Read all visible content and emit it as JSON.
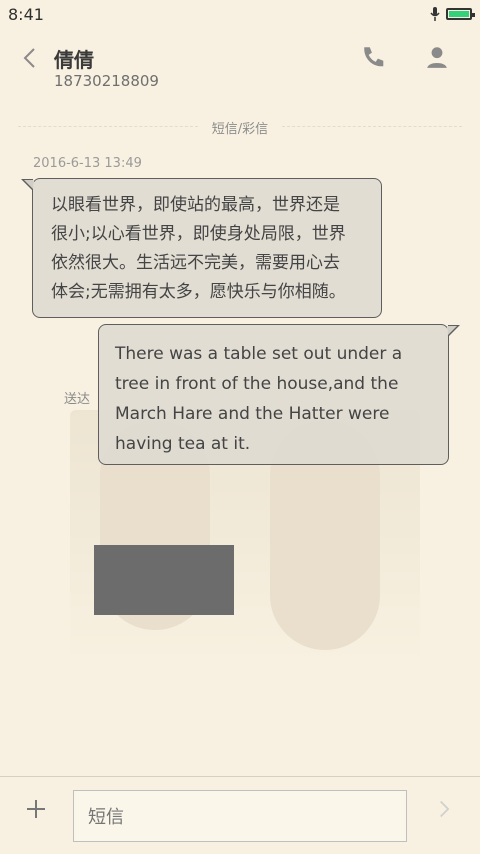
{
  "status_bar": {
    "time": "8:41"
  },
  "header": {
    "contact_name": "倩倩",
    "phone_number": "18730218809",
    "icons": [
      "back-icon",
      "phone-icon",
      "contact-icon"
    ]
  },
  "conversation": {
    "section_label": "短信/彩信",
    "timestamp": "2016-6-13 13:49",
    "messages": [
      {
        "direction": "incoming",
        "lines": [
          "以眼看世界，即使站的最高，世界还是",
          "很小;以心看世界，即使身处局限，世界",
          "依然很大。生活远不完美，需要用心去",
          "体会;无需拥有太多，愿快乐与你相随。"
        ]
      },
      {
        "direction": "outgoing",
        "lines": [
          "There was a table set out under a",
          "tree in front of the house,and the",
          "March Hare and the Hatter were",
          "having tea at it."
        ],
        "status": "送达"
      }
    ]
  },
  "composer": {
    "placeholder": "短信",
    "icons": [
      "add-icon",
      "send-icon"
    ]
  },
  "colors": {
    "background": "#f8f1e1",
    "bubble_border": "#5e5e5e",
    "bubble_fill": "#ded9d1",
    "battery": "#33d17a"
  }
}
